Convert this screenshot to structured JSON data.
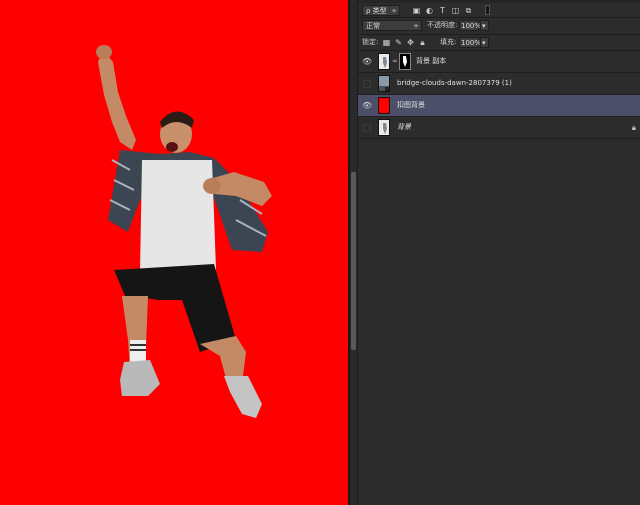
{
  "canvas": {
    "background_color": "#ff0000"
  },
  "layers_panel": {
    "filter": {
      "kind_label": "ρ 类型"
    },
    "blend": {
      "mode": "正常",
      "opacity_label": "不透明度:",
      "opacity_value": "100%"
    },
    "lock": {
      "label": "锁定:",
      "fill_label": "填充:",
      "fill_value": "100%"
    },
    "layers": [
      {
        "name": "背景 副本",
        "visible": true,
        "selected": false
      },
      {
        "name": "bridge-clouds-dawn-2807379 (1)",
        "visible": false,
        "selected": false
      },
      {
        "name": "扣图背景",
        "visible": true,
        "selected": true
      },
      {
        "name": "背景",
        "visible": false,
        "selected": false,
        "locked": true
      }
    ]
  },
  "colors": {
    "panel": "#2c2c2c",
    "selected_layer": "#4b5068",
    "canvas_red": "#ff0000"
  }
}
